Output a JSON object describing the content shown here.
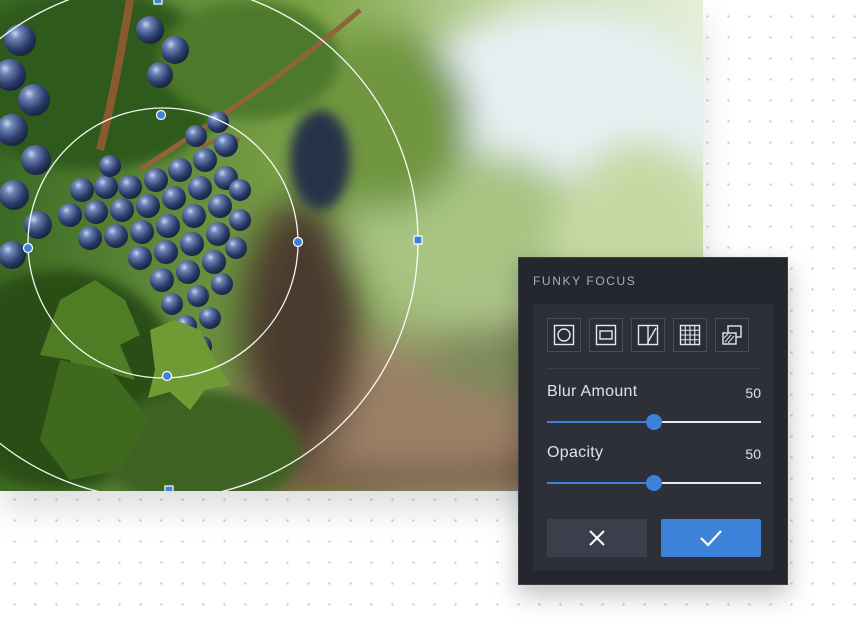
{
  "panel": {
    "title": "FUNKY FOCUS",
    "tools": [
      {
        "icon": "radial-focus-icon",
        "selected": true
      },
      {
        "icon": "rectangle-focus-icon"
      },
      {
        "icon": "split-focus-icon"
      },
      {
        "icon": "grid-focus-icon"
      },
      {
        "icon": "layers-focus-icon"
      }
    ],
    "blur": {
      "label": "Blur Amount",
      "value": "50",
      "fraction": 0.5
    },
    "opacity": {
      "label": "Opacity",
      "value": "50",
      "fraction": 0.5
    },
    "cancel_icon": "close-icon",
    "confirm_icon": "check-icon"
  },
  "colors": {
    "accent": "#3c82d8",
    "panel_bg": "#25272f",
    "panel_inner": "#2d3039"
  }
}
